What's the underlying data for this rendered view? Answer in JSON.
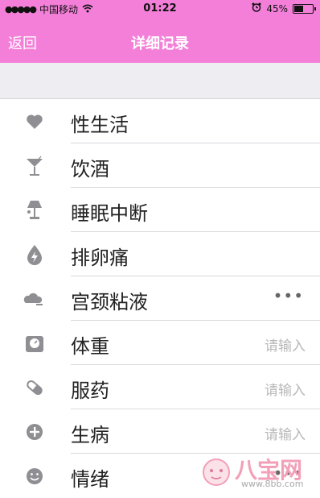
{
  "status_bar": {
    "signal": "●●●●●",
    "carrier": "中国移动",
    "wifi_icon": "wifi-icon",
    "time": "01:22",
    "alarm_icon": "alarm-clock-icon",
    "battery_percent": "45%",
    "battery_level": 0.45
  },
  "nav": {
    "back_label": "返回",
    "title": "详细记录"
  },
  "list": {
    "items": [
      {
        "icon": "heart-icon",
        "label": "性生活"
      },
      {
        "icon": "cocktail-icon",
        "label": "饮酒"
      },
      {
        "icon": "lamp-icon",
        "label": "睡眠中断"
      },
      {
        "icon": "lightning-drop-icon",
        "label": "排卵痛"
      },
      {
        "icon": "cloud-icon",
        "label": "宫颈粘液",
        "value": "•••"
      },
      {
        "icon": "scale-icon",
        "label": "体重",
        "value": "请输入"
      },
      {
        "icon": "pill-icon",
        "label": "服药",
        "value": "请输入"
      },
      {
        "icon": "plus-circle-icon",
        "label": "生病",
        "value": "请输入"
      },
      {
        "icon": "smiley-icon",
        "label": "情绪",
        "value": "•••"
      }
    ]
  },
  "watermark": {
    "brand": "八宝网",
    "site": "www.8bb.com"
  },
  "colors": {
    "accent": "#f47fd9",
    "icon": "#8e8e93",
    "separator": "#d9d9dd",
    "section_bg": "#eeeef2"
  }
}
